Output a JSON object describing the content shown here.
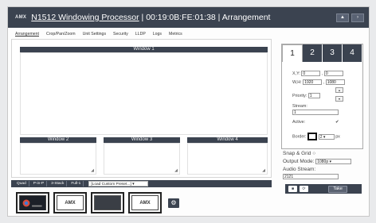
{
  "header": {
    "brand": "AMX",
    "device_name": "N1512 Windowing Processor",
    "title_rest": " | 00:19:0B:FE:01:38 | Arrangement",
    "up_button": "▲",
    "next_button": "›"
  },
  "menu": {
    "items": [
      "Arrangement",
      "Crop/Pan/Zoom",
      "Unit Settings",
      "Security",
      "LLDP",
      "Logs",
      "Metrics"
    ]
  },
  "windows": {
    "w1": "Window 1",
    "w2": "Window 2",
    "w3": "Window 3",
    "w4": "Window 4",
    "resize_glyph": "◢"
  },
  "layout_bar": {
    "buttons": [
      "Quad",
      "P-in-P",
      "3-Stack",
      "Full-1"
    ],
    "preset_selected": "[Load Custom Preset...]",
    "preset_arrow": "▾"
  },
  "thumbnails": {
    "t1": "",
    "t2": "AMX",
    "t3": "",
    "t4": "AMX",
    "gear": "⚙"
  },
  "panel": {
    "tabs": [
      "1",
      "2",
      "3",
      "4"
    ],
    "xy_label": "X,Y:",
    "x_value": "0",
    "y_value": "0",
    "wh_label": "W,H:",
    "w_value": "1920",
    "h_value": "1080",
    "priority_label": "Priority:",
    "priority_value": "1",
    "spin_up": "▴",
    "spin_down": "▾",
    "stream_label": "Stream:",
    "stream_value": "1",
    "active_label": "Active:",
    "active_check": "✔",
    "border_label": "Border:",
    "border_value": "2",
    "border_unit": "px",
    "comma": ","
  },
  "settings": {
    "snap_label": "Snap & Grid",
    "snap_radio": "○",
    "output_label": "Output Mode:",
    "output_value": "1080p",
    "output_arrow": "▾",
    "audio_label": "Audio Stream:",
    "audio_value": "2121"
  },
  "actions": {
    "save": "■",
    "refresh": "⟳",
    "take": "Take"
  }
}
